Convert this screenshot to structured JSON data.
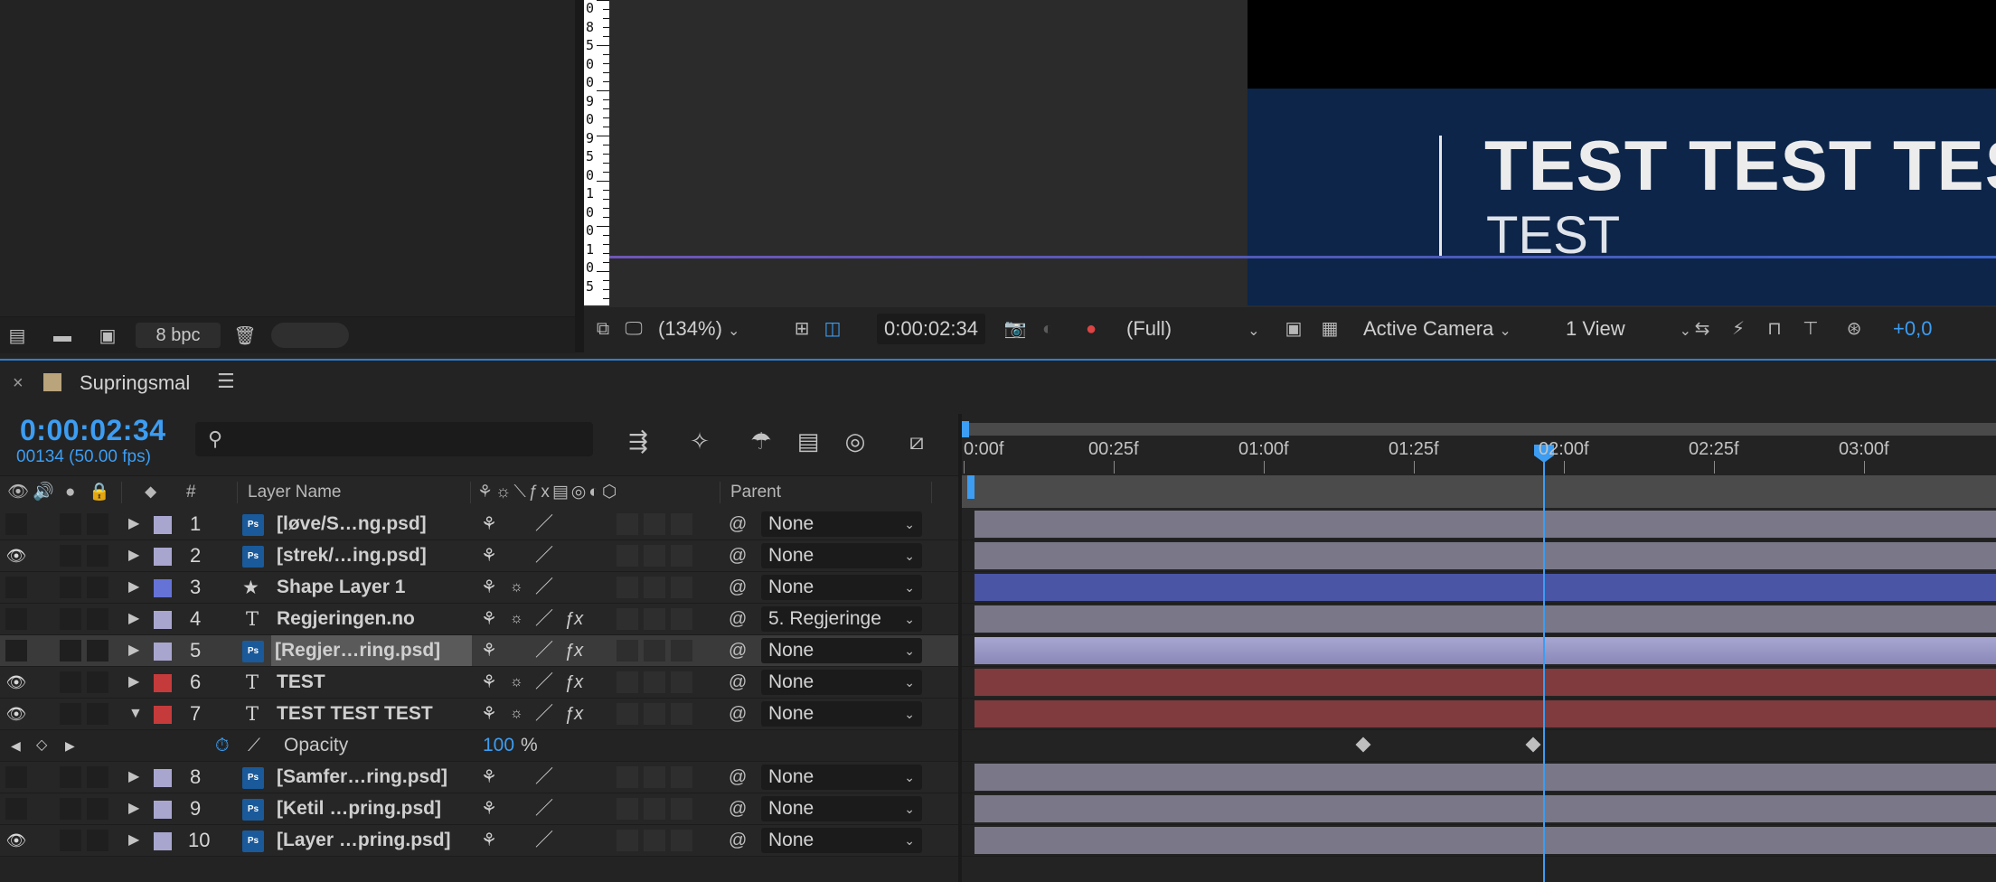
{
  "project": {
    "bpc_label": "8 bpc",
    "footer_icons": [
      "interpret-footage-icon",
      "new-folder-icon",
      "new-composition-icon",
      "trash-icon"
    ]
  },
  "viewer": {
    "ruler_labels": [
      "0",
      "8",
      "5",
      "0",
      "0",
      "9",
      "0",
      "9",
      "5",
      "0",
      "1",
      "0",
      "0",
      "1",
      "0",
      "5"
    ],
    "comp_title": "TEST TEST TEST",
    "comp_subtitle": "TEST",
    "toolbar": {
      "zoom": "(134%)",
      "timecode": "0:00:02:34",
      "resolution": "(Full)",
      "camera": "Active Camera",
      "views": "1 View",
      "exposure": "+0,0"
    }
  },
  "timeline": {
    "close_glyph": "×",
    "comp_name": "Supringsmal",
    "menu_glyph": "☰",
    "current_time": "0:00:02:34",
    "frame_info": "00134 (50.00 fps)",
    "ruler": [
      "0:00f",
      "00:25f",
      "01:00f",
      "01:25f",
      "02:00f",
      "02:25f",
      "03:00f"
    ],
    "current_time_fraction": 0.56,
    "columns": {
      "number": "#",
      "layer_name": "Layer Name",
      "parent": "Parent"
    },
    "layers": [
      {
        "num": "1",
        "type": "ps",
        "name": "[løve/S…ng.psd]",
        "label_color": "#a8a6cf",
        "eye": false,
        "parent": "None",
        "bar_color": "#7a7888",
        "fx": false,
        "star": false,
        "selected": false
      },
      {
        "num": "2",
        "type": "ps",
        "name": "[strek/…ing.psd]",
        "label_color": "#a8a6cf",
        "eye": true,
        "parent": "None",
        "bar_color": "#7a7888",
        "fx": false,
        "star": false,
        "selected": false
      },
      {
        "num": "3",
        "type": "shape",
        "name": "Shape Layer 1",
        "label_color": "#6673d6",
        "eye": false,
        "parent": "None",
        "bar_color": "#4a55a6",
        "fx": false,
        "star": true,
        "selected": false
      },
      {
        "num": "4",
        "type": "text",
        "name": "Regjeringen.no",
        "label_color": "#a8a6cf",
        "eye": false,
        "parent": "5. Regjeringe",
        "bar_color": "#7a7888",
        "fx": true,
        "star": true,
        "selected": false
      },
      {
        "num": "5",
        "type": "ps",
        "name": "[Regjer…ring.psd]",
        "label_color": "#a8a6cf",
        "eye": false,
        "parent": "None",
        "bar_color": "#9290b8",
        "fx": true,
        "star": false,
        "selected": true
      },
      {
        "num": "6",
        "type": "text",
        "name": "TEST",
        "label_color": "#c53b3b",
        "eye": true,
        "parent": "None",
        "bar_color": "#7f3b3e",
        "fx": true,
        "star": true,
        "selected": false
      },
      {
        "num": "7",
        "type": "text",
        "name": "TEST TEST TEST",
        "label_color": "#c53b3b",
        "eye": true,
        "parent": "None",
        "bar_color": "#7f3b3e",
        "fx": true,
        "star": true,
        "selected": false,
        "expanded": true
      }
    ],
    "opacity_prop": {
      "label": "Opacity",
      "value": "100",
      "unit": "%",
      "keyframes_at": [
        "01:07f",
        "01:42f"
      ]
    },
    "layers_after": [
      {
        "num": "8",
        "type": "ps",
        "name": "[Samfer…ring.psd]",
        "label_color": "#a8a6cf",
        "eye": false,
        "parent": "None",
        "bar_color": "#7a7888"
      },
      {
        "num": "9",
        "type": "ps",
        "name": "[Ketil …pring.psd]",
        "label_color": "#a8a6cf",
        "eye": false,
        "parent": "None",
        "bar_color": "#7a7888"
      },
      {
        "num": "10",
        "type": "ps",
        "name": "[Layer …pring.psd]",
        "label_color": "#a8a6cf",
        "eye": true,
        "parent": "None",
        "bar_color": "#7a7888"
      }
    ]
  }
}
